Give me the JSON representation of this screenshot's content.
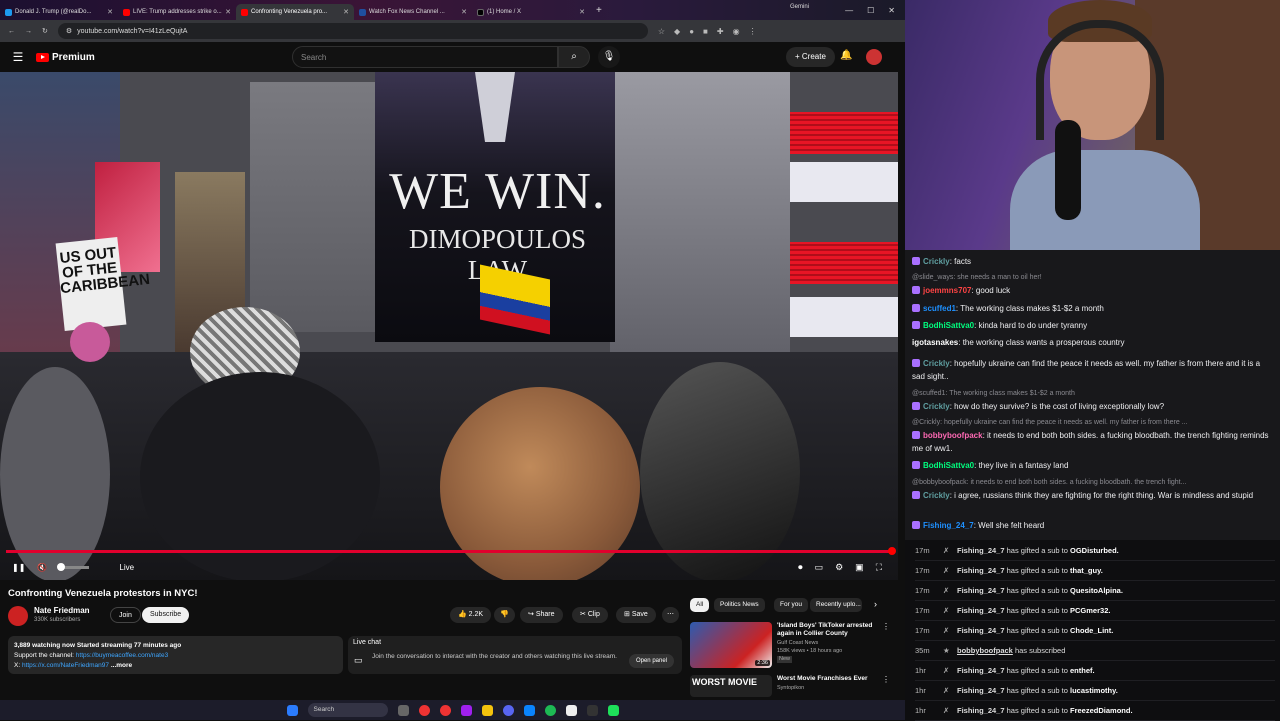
{
  "browser": {
    "tabs": [
      {
        "title": "Donald J. Trump (@realDo...",
        "color": "#1d9bf0"
      },
      {
        "title": "LIVE: Trump addresses strike o...",
        "color": "#ff0000"
      },
      {
        "title": "Confronting Venezuela pro...",
        "color": "#ff0000",
        "active": true
      },
      {
        "title": "Watch Fox News Channel ...",
        "color": "#1f4fa0"
      },
      {
        "title": "(1) Home / X",
        "color": "#000000"
      }
    ],
    "extra_tab": "Gemini",
    "url": "youtube.com/watch?v=I41zLeQujtA"
  },
  "youtube": {
    "brand": "Premium",
    "search_placeholder": "Search",
    "create_label": "+ Create",
    "video": {
      "billboard_line1": "WE WIN.",
      "billboard_line2": "DIMOPOULOS LAW",
      "sign_text": "US OUT OF THE CARIBBEAN",
      "live_label": "Live",
      "progress": 1.0
    },
    "title": "Confronting Venezuela protestors in NYC!",
    "channel": "Nate Friedman",
    "subscribers": "330K subscribers",
    "join_label": "Join",
    "subscribe_label": "Subscribe",
    "likes": "2.2K",
    "share_label": "Share",
    "clip_label": "Clip",
    "save_label": "Save",
    "desc_line1": "3,889 watching now  Started streaming 77 minutes ago",
    "desc_line2_prefix": "Support the channel: ",
    "desc_line2_link": "https://buymeacoffee.com/nate3",
    "desc_line3_prefix": "X: ",
    "desc_line3_link": "https://x.com/NateFriedman97",
    "desc_more": "...more",
    "livechat_title": "Live chat",
    "livechat_msg": "Join the conversation to interact with the creator and others watching this live stream.",
    "open_panel": "Open panel",
    "chips": [
      "All",
      "Politics News",
      "For you",
      "Recently uplo..."
    ],
    "recs": [
      {
        "title": "'Island Boys' TikToker arrested again in Collier County",
        "channel": "Gulf Coast News",
        "meta": "158K views • 18 hours ago",
        "badge": "New",
        "duration": "2:36"
      },
      {
        "title": "Worst Movie Franchises Ever",
        "channel": "Syntopikon",
        "meta": "",
        "badge": "",
        "duration": ""
      }
    ]
  },
  "taskbar": {
    "search": "Search"
  },
  "chat": [
    {
      "user": "Crickly",
      "color": "#5f9ea0",
      "text": "facts"
    },
    {
      "reply": true,
      "text": "@slide_ways: she needs a man to oil her!"
    },
    {
      "user": "joemmns707",
      "color": "#ff4444",
      "text": "good luck"
    },
    {
      "user": "scuffed1",
      "color": "#1e90ff",
      "text": "The working class makes $1-$2 a month"
    },
    {
      "user": "BodhiSattva0",
      "color": "#00ff7f",
      "text": "kinda hard to do under tyranny"
    },
    {
      "user": "igotasnakes",
      "color": "#ffffff",
      "text": "the working class wants a prosperous country"
    },
    {
      "user": "Crickly",
      "color": "#5f9ea0",
      "text": "hopefully ukraine can find the peace it needs as well. my father is from there and it is a sad sight.."
    },
    {
      "reply": true,
      "text": "@scuffed1: The working class makes $1-$2 a month"
    },
    {
      "user": "Crickly",
      "color": "#5f9ea0",
      "text": "how do they survive? is the cost of living exceptionally low?"
    },
    {
      "reply": true,
      "text": "@Crickly: hopefully ukraine can find the peace it needs as well. my father is from there ..."
    },
    {
      "user": "bobbyboofpack",
      "color": "#ff69b4",
      "text": "it needs to end both both sides. a fucking bloodbath. the trench fighting reminds me of ww1."
    },
    {
      "user": "BodhiSattva0",
      "color": "#00ff7f",
      "text": "they live in a fantasy land"
    },
    {
      "reply": true,
      "text": "@bobbyboofpack: it needs to end both both sides. a fucking bloodbath. the trench fight..."
    },
    {
      "user": "Crickly",
      "color": "#5f9ea0",
      "text": "i agree, russians think they are fighting for the right thing. War is mindless and stupid"
    },
    {
      "user": "Fishing_24_7",
      "color": "#1e90ff",
      "text": "Well she felt heard"
    }
  ],
  "events": [
    {
      "time": "17m",
      "user": "Fishing_24_7",
      "action": "has gifted a sub to",
      "target": "OGDisturbed."
    },
    {
      "time": "17m",
      "user": "Fishing_24_7",
      "action": "has gifted a sub to",
      "target": "that_guy."
    },
    {
      "time": "17m",
      "user": "Fishing_24_7",
      "action": "has gifted a sub to",
      "target": "QuesitoAlpina."
    },
    {
      "time": "17m",
      "user": "Fishing_24_7",
      "action": "has gifted a sub to",
      "target": "PCGmer32."
    },
    {
      "time": "17m",
      "user": "Fishing_24_7",
      "action": "has gifted a sub to",
      "target": "Chode_Lint."
    },
    {
      "time": "35m",
      "user": "bobbyboofpack",
      "action": "has subscribed",
      "target": ""
    },
    {
      "time": "1hr",
      "user": "Fishing_24_7",
      "action": "has gifted a sub to",
      "target": "enthef."
    },
    {
      "time": "1hr",
      "user": "Fishing_24_7",
      "action": "has gifted a sub to",
      "target": "lucastimothy."
    },
    {
      "time": "1hr",
      "user": "Fishing_24_7",
      "action": "has gifted a sub to",
      "target": "FreezedDiamond."
    }
  ]
}
